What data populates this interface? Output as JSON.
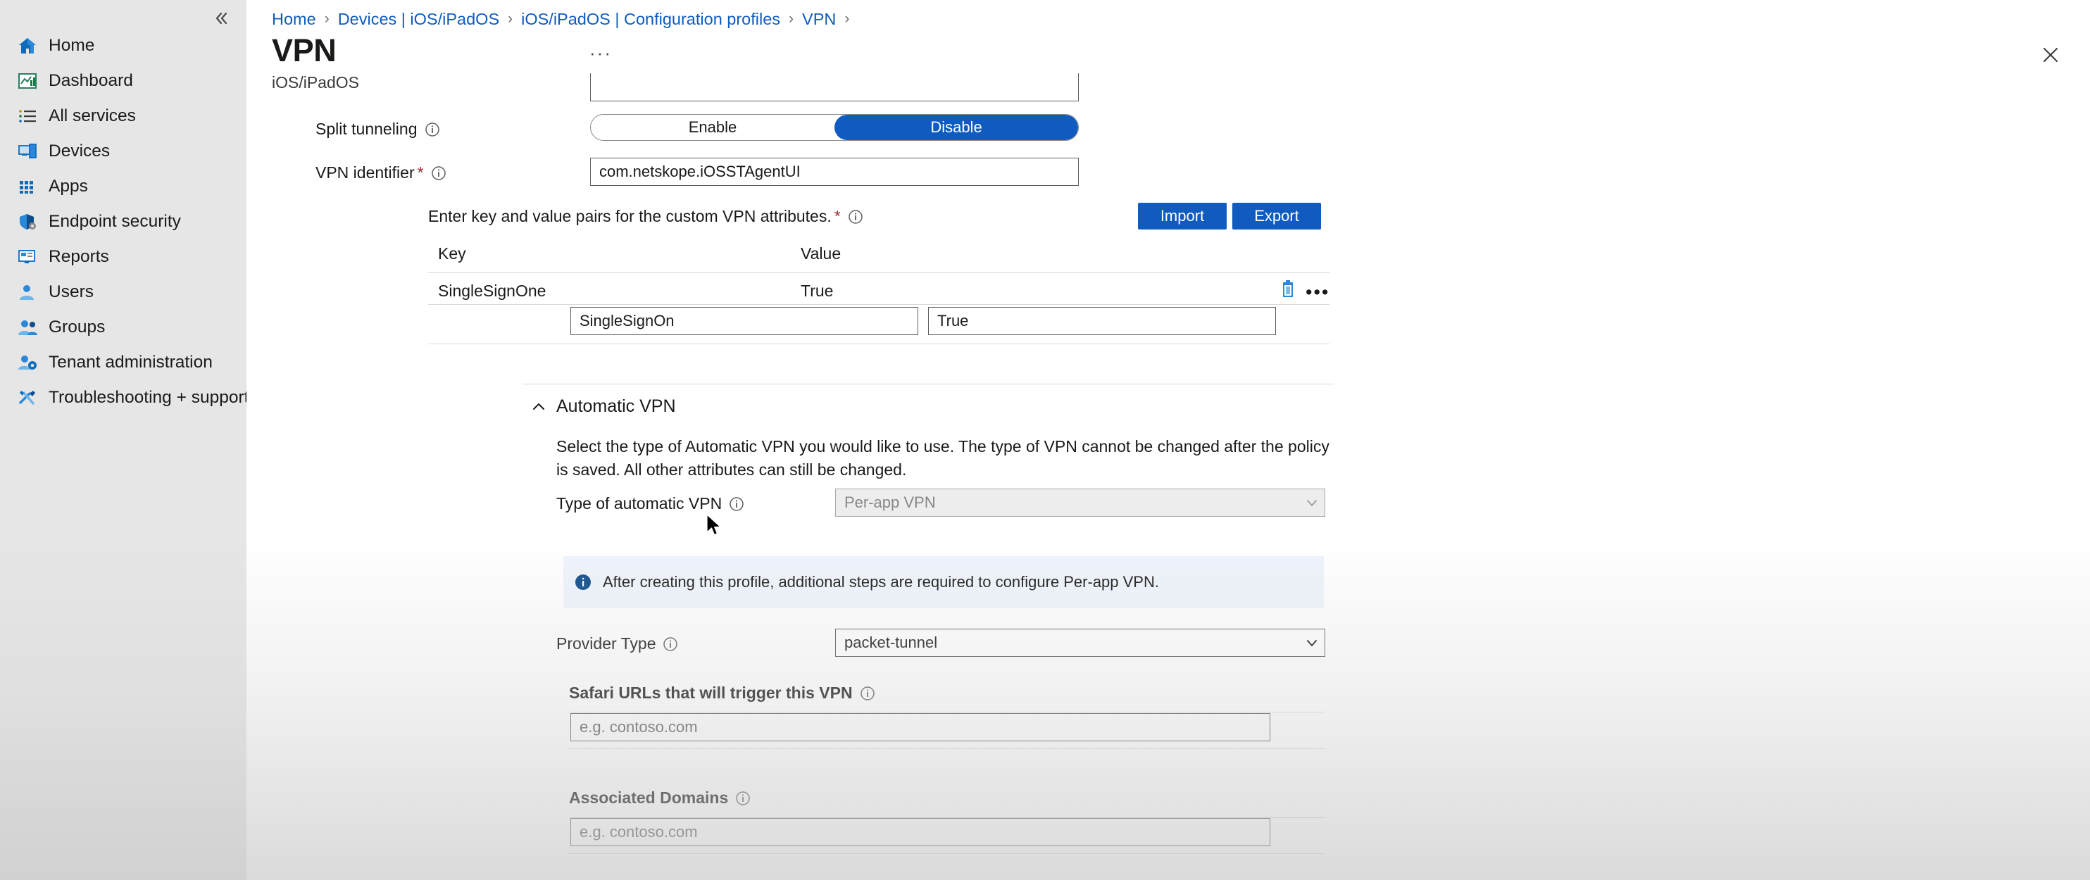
{
  "sidebar": {
    "collapse_label": "«",
    "items": [
      {
        "label": "Home",
        "icon": "home-icon"
      },
      {
        "label": "Dashboard",
        "icon": "dashboard-icon"
      },
      {
        "label": "All services",
        "icon": "all-services-icon"
      },
      {
        "label": "Devices",
        "icon": "devices-icon"
      },
      {
        "label": "Apps",
        "icon": "apps-icon"
      },
      {
        "label": "Endpoint security",
        "icon": "shield-icon"
      },
      {
        "label": "Reports",
        "icon": "reports-icon"
      },
      {
        "label": "Users",
        "icon": "user-icon"
      },
      {
        "label": "Groups",
        "icon": "groups-icon"
      },
      {
        "label": "Tenant administration",
        "icon": "tenant-admin-icon"
      },
      {
        "label": "Troubleshooting + support",
        "icon": "tools-icon"
      }
    ]
  },
  "breadcrumb": [
    "Home",
    "Devices | iOS/iPadOS",
    "iOS/iPadOS | Configuration profiles",
    "VPN"
  ],
  "header": {
    "title": "VPN",
    "more_label": "···",
    "subtitle": "iOS/iPadOS",
    "close_label": "close-icon"
  },
  "form": {
    "split_tunneling": {
      "label": "Split tunneling",
      "options": [
        "Enable",
        "Disable"
      ],
      "selected": "Disable"
    },
    "vpn_identifier": {
      "label": "VPN identifier",
      "required_marker": "*",
      "value": "com.netskope.iOSSTAgentUI"
    },
    "custom_attributes": {
      "label": "Enter key and value pairs for the custom VPN attributes.",
      "required_marker": "*",
      "import_label": "Import",
      "export_label": "Export",
      "columns": [
        "Key",
        "Value"
      ],
      "rows": [
        {
          "key": "SingleSignOne",
          "value": "True"
        }
      ],
      "edit_row": {
        "key": "SingleSignOn",
        "value": "True"
      }
    },
    "automatic_vpn": {
      "section_title": "Automatic VPN",
      "description": "Select the type of Automatic VPN you would like to use. The type of VPN cannot be changed after the policy is saved. All other attributes can still be changed.",
      "type_label": "Type of automatic VPN",
      "type_value": "Per-app VPN",
      "banner_text": "After creating this profile, additional steps are required to configure Per-app VPN.",
      "provider_type_label": "Provider Type",
      "provider_type_value": "packet-tunnel",
      "safari_urls_label": "Safari URLs that will trigger this VPN",
      "safari_urls_placeholder": "e.g. contoso.com",
      "safari_urls_value": "",
      "associated_domains_label": "Associated Domains",
      "associated_domains_placeholder": "e.g. contoso.com",
      "associated_domains_value": ""
    }
  },
  "colors": {
    "accent_blue": "#0f5bbf",
    "link_blue": "#0f5bbf",
    "required_red": "#a4262c",
    "banner_bg": "#eff4fc",
    "sidebar_bg": "#e6e6e6"
  }
}
